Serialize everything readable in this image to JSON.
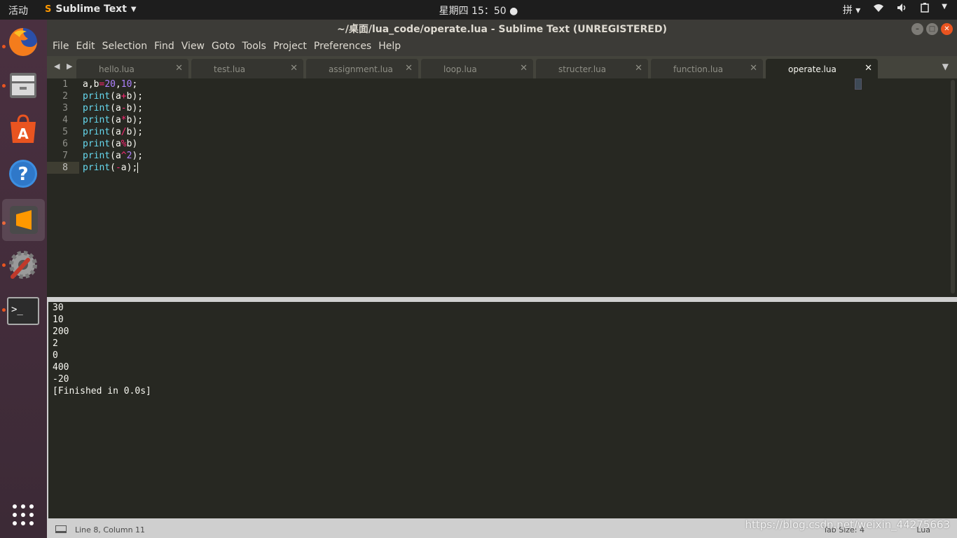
{
  "topbar": {
    "activities": "活动",
    "app_name": "Sublime Text",
    "clock": "星期四 15：50",
    "ime": "拼"
  },
  "window": {
    "title": "~/桌面/lua_code/operate.lua - Sublime Text (UNREGISTERED)"
  },
  "menu": [
    "File",
    "Edit",
    "Selection",
    "Find",
    "View",
    "Goto",
    "Tools",
    "Project",
    "Preferences",
    "Help"
  ],
  "tabs": [
    "hello.lua",
    "test.lua",
    "assignment.lua",
    "loop.lua",
    "structer.lua",
    "function.lua",
    "operate.lua"
  ],
  "active_tab": "operate.lua",
  "editor": {
    "line_numbers": [
      "1",
      "2",
      "3",
      "4",
      "5",
      "6",
      "7",
      "8"
    ],
    "current_line": 8,
    "lines": [
      "a,b=20,10;",
      "print(a+b);",
      "print(a-b);",
      "print(a*b);",
      "print(a/b);",
      "print(a%b)",
      "print(a^2);",
      "print(-a);"
    ]
  },
  "output": [
    "30",
    "10",
    "200",
    "2",
    "0",
    "400",
    "-20",
    "[Finished in 0.0s]"
  ],
  "statusbar": {
    "position": "Line 8, Column 11",
    "tab_size": "Tab Size: 4",
    "syntax": "Lua"
  },
  "watermark": "https://blog.csdn.net/weixin_44275663",
  "colors": {
    "editor_bg": "#272822",
    "keyword_fn": "#66d9ef",
    "operator": "#f92672",
    "number": "#ae81ff",
    "accent": "#e95420"
  }
}
